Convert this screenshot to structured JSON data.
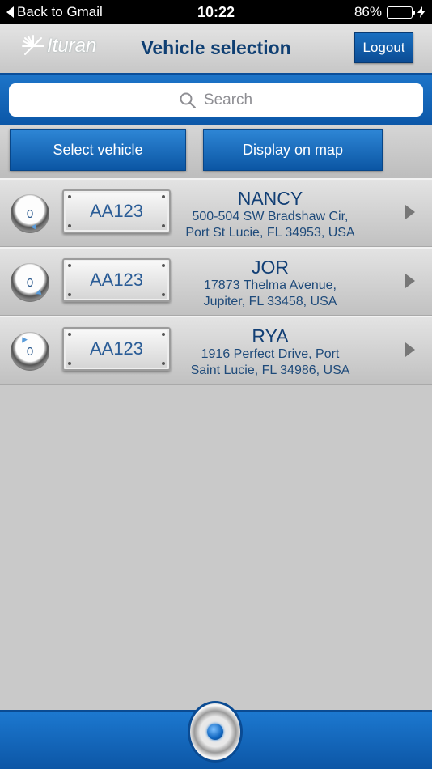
{
  "status_bar": {
    "back_label": "Back to Gmail",
    "time": "10:22",
    "battery_percent": "86%",
    "battery_level": 0.86
  },
  "header": {
    "logo_text": "Ituran",
    "title": "Vehicle selection",
    "logout_label": "Logout"
  },
  "search": {
    "placeholder": "Search"
  },
  "actions": {
    "select_vehicle_label": "Select vehicle",
    "display_on_map_label": "Display on map"
  },
  "vehicles": [
    {
      "dial_value": "0",
      "plate": "AA123",
      "name": "NANCY",
      "address_line1": "500-504 SW Bradshaw Cir,",
      "address_line2": "Port St Lucie, FL 34953, USA"
    },
    {
      "dial_value": "0",
      "plate": "AA123",
      "name": "JOR",
      "address_line1": "17873 Thelma Avenue,",
      "address_line2": "Jupiter, FL 33458, USA"
    },
    {
      "dial_value": "0",
      "plate": "AA123",
      "name": "RYA",
      "address_line1": "1916 Perfect Drive, Port",
      "address_line2": "Saint Lucie, FL 34986, USA"
    }
  ],
  "colors": {
    "brand_blue": "#0b56a4",
    "title_blue": "#0f3f73",
    "battery_green": "#4cd964"
  }
}
